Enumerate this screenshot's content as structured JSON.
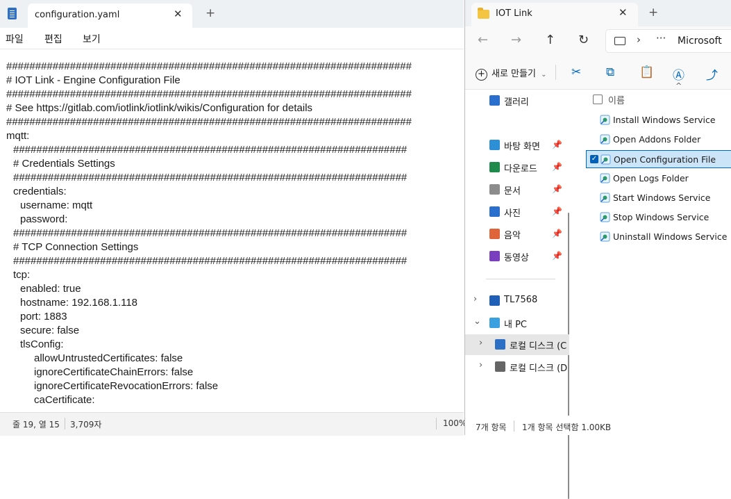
{
  "notepad": {
    "tab_title": "configuration.yaml",
    "close_glyph": "✕",
    "new_tab_glyph": "+",
    "menu": [
      "파일",
      "편집",
      "보기"
    ],
    "lines": [
      {
        "indent": 0,
        "text": "######################################################################"
      },
      {
        "indent": 0,
        "text": "# IOT Link - Engine Configuration File"
      },
      {
        "indent": 0,
        "text": "######################################################################"
      },
      {
        "indent": 0,
        "text": "# See https://gitlab.com/iotlink/iotlink/wikis/Configuration for details"
      },
      {
        "indent": 0,
        "text": "######################################################################"
      },
      {
        "indent": 0,
        "text": "mqtt:"
      },
      {
        "indent": 1,
        "text": "####################################################################"
      },
      {
        "indent": 1,
        "text": "# Credentials Settings"
      },
      {
        "indent": 1,
        "text": "####################################################################"
      },
      {
        "indent": 1,
        "text": "credentials:"
      },
      {
        "indent": 2,
        "text": "username: mqtt"
      },
      {
        "indent": 2,
        "text": "password:"
      },
      {
        "indent": 1,
        "text": "####################################################################"
      },
      {
        "indent": 1,
        "text": "# TCP Connection Settings"
      },
      {
        "indent": 1,
        "text": "####################################################################"
      },
      {
        "indent": 1,
        "text": "tcp:"
      },
      {
        "indent": 2,
        "text": "enabled: true"
      },
      {
        "indent": 2,
        "text": "hostname: 192.168.1.118"
      },
      {
        "indent": 2,
        "text": "port: 1883"
      },
      {
        "indent": 2,
        "text": "secure: false"
      },
      {
        "indent": 2,
        "text": "tlsConfig:"
      },
      {
        "indent": 4,
        "text": "allowUntrustedCertificates: false"
      },
      {
        "indent": 4,
        "text": "ignoreCertificateChainErrors: false"
      },
      {
        "indent": 4,
        "text": "ignoreCertificateRevocationErrors: false"
      },
      {
        "indent": 4,
        "text": "caCertificate:"
      }
    ],
    "status": {
      "position": "줄 19, 열 15",
      "chars": "3,709자",
      "zoom": "100%"
    }
  },
  "explorer": {
    "tab_title": "IOT Link",
    "close_glyph": "✕",
    "new_tab_glyph": "+",
    "nav": {
      "back": "←",
      "forward": "→",
      "up": "↑",
      "refresh": "↻"
    },
    "address": {
      "chevron": "›",
      "dots": "···",
      "crumb": "Microsoft"
    },
    "command_bar": {
      "new_label": "새로 만들기",
      "new_chevron": "⌄"
    },
    "sort_chevron": "^",
    "sidebar": {
      "quick": [
        {
          "label": "갤러리",
          "pinned": false,
          "color": "#2b6fce"
        },
        {
          "label": "바탕 화면",
          "pinned": true,
          "color": "#2d8fd6"
        },
        {
          "label": "다운로드",
          "pinned": true,
          "color": "#1f8a4c"
        },
        {
          "label": "문서",
          "pinned": true,
          "color": "#8c8c8c"
        },
        {
          "label": "사진",
          "pinned": true,
          "color": "#2b6fce"
        },
        {
          "label": "음악",
          "pinned": true,
          "color": "#e0643a"
        },
        {
          "label": "동영상",
          "pinned": true,
          "color": "#7a3fbf"
        }
      ],
      "pin_glyph": "📌",
      "tree": [
        {
          "label": "TL7568",
          "expander": "›",
          "color": "#1f5fb8",
          "indent": 0
        },
        {
          "label": "내 PC",
          "expander": "⌄",
          "color": "#3aa0e0",
          "indent": 0
        },
        {
          "label": "로컬 디스크 (C",
          "expander": "›",
          "color": "#2d6fc4",
          "indent": 1,
          "selected": true
        },
        {
          "label": "로컬 디스크 (D",
          "expander": "›",
          "color": "#666666",
          "indent": 1
        }
      ]
    },
    "list": {
      "header": "이름",
      "files": [
        {
          "name": "Install Windows Service",
          "selected": false
        },
        {
          "name": "Open Addons Folder",
          "selected": false
        },
        {
          "name": "Open Configuration File",
          "selected": true
        },
        {
          "name": "Open Logs Folder",
          "selected": false
        },
        {
          "name": "Start Windows Service",
          "selected": false
        },
        {
          "name": "Stop Windows Service",
          "selected": false
        },
        {
          "name": "Uninstall Windows Service",
          "selected": false
        }
      ]
    },
    "status": {
      "count": "7개 항목",
      "selection": "1개 항목 선택함 1.00KB"
    }
  }
}
